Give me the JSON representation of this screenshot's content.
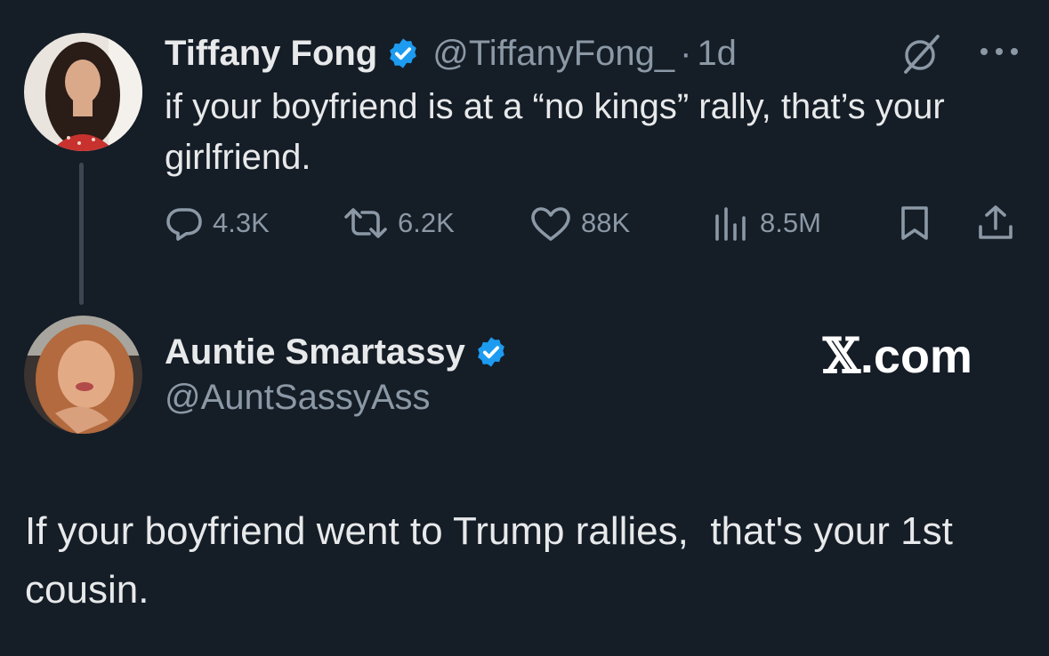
{
  "tweet1": {
    "author_name": "Tiffany Fong",
    "handle": "@TiffanyFong_",
    "separator": "·",
    "time": "1d",
    "text": "if your boyfriend is at a “no kings” rally, that’s your girlfriend.",
    "replies": "4.3K",
    "retweets": "6.2K",
    "likes": "88K",
    "views": "8.5M",
    "icons": [
      "verified-badge-icon",
      "grok-icon",
      "more-icon",
      "reply-icon",
      "retweet-icon",
      "like-icon",
      "views-icon",
      "bookmark-icon",
      "share-icon"
    ]
  },
  "tweet2": {
    "author_name": "Auntie Smartassy",
    "handle": "@AuntSassyAss",
    "text": "If your boyfriend went to Trump rallies,  that's your 1st cousin."
  },
  "watermark": {
    "mark": "𝕏",
    "text": ".com"
  },
  "colors": {
    "background": "#151d27",
    "primary_text": "#e7e9ea",
    "secondary_text": "#8b98a5",
    "verified_blue": "#1d9bf0",
    "thread_line": "#3d4650"
  }
}
